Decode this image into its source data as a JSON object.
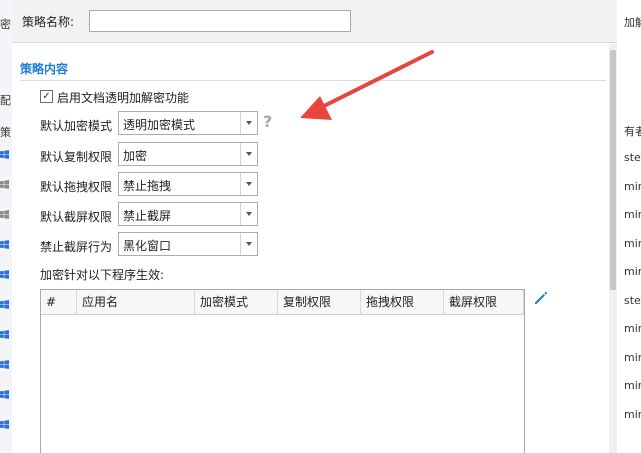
{
  "background": {
    "left_texts": [
      "密",
      "配",
      "策"
    ],
    "right_texts": [
      "加解",
      "有者",
      "ste",
      "min",
      "min",
      "min",
      "min",
      "ste",
      "min",
      "min",
      "min",
      "min"
    ]
  },
  "dialog": {
    "name_label": "策略名称:",
    "name_value": "",
    "section_title": "策略内容",
    "enable_label": "启用文档透明加解密功能",
    "enable_checked": "✓",
    "options": [
      {
        "label": "默认加密模式",
        "value": "透明加密模式"
      },
      {
        "label": "默认复制权限",
        "value": "加密"
      },
      {
        "label": "默认拖拽权限",
        "value": "禁止拖拽"
      },
      {
        "label": "默认截屏权限",
        "value": "禁止截屏"
      },
      {
        "label": "禁止截屏行为",
        "value": "黑化窗口"
      }
    ],
    "help_glyph": "?",
    "apps_label": "加密针对以下程序生效:",
    "table": {
      "columns": [
        "#",
        "应用名",
        "加密模式",
        "复制权限",
        "拖拽权限",
        "截屏权限"
      ],
      "rows": []
    }
  },
  "colors": {
    "accent": "#1e7fd6",
    "annotation_arrow": "#e8463c",
    "windows_logo": "#2b6fd8"
  }
}
